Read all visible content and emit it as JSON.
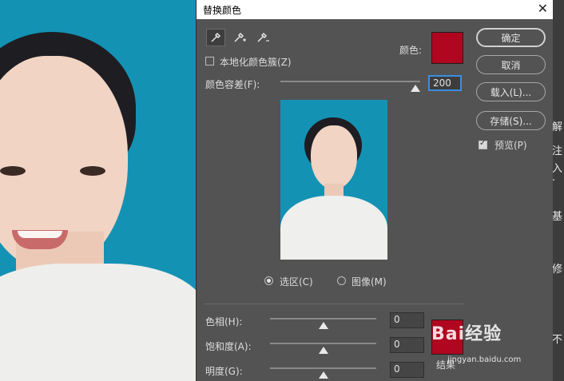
{
  "dialog": {
    "title": "替换颜色",
    "close_glyph": "✕"
  },
  "localized_color_clusters": {
    "label": "本地化颜色簇(Z)",
    "checked": false
  },
  "color": {
    "label": "颜色:",
    "swatch_color": "#b0061f"
  },
  "fuzziness": {
    "label": "颜色容差(F):",
    "value": "200",
    "slider_fraction": 1.0
  },
  "selection_mode": {
    "selection_label": "选区(C)",
    "image_label": "图像(M)",
    "selected": "selection"
  },
  "hue": {
    "label": "色相(H):",
    "value": "0",
    "slider_fraction": 0.5
  },
  "saturation": {
    "label": "饱和度(A):",
    "value": "0",
    "slider_fraction": 0.5
  },
  "lightness": {
    "label": "明度(G):",
    "value": "0",
    "slider_fraction": 0.5
  },
  "result": {
    "label": "结果",
    "swatch_color": "#b0061f"
  },
  "buttons": {
    "ok": "确定",
    "cancel": "取消",
    "load": "载入(L)...",
    "save": "存储(S)..."
  },
  "preview_option": {
    "label": "预览(P)",
    "checked": true
  },
  "watermark": {
    "text": "Bai经验",
    "url": "jingyan.baidu.com"
  },
  "right_panel_fragments": [
    "解",
    "注",
    "入·",
    "基",
    "修",
    "不"
  ]
}
